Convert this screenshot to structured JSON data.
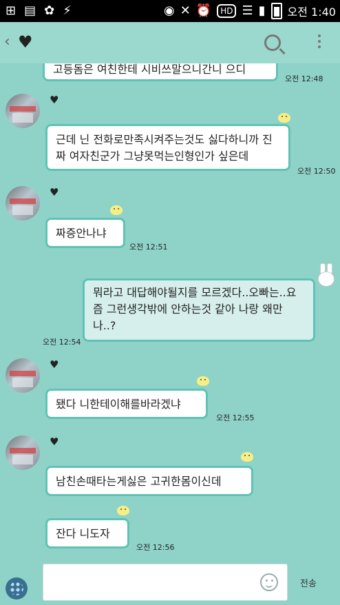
{
  "status_bar": {
    "clock": "오전 1:40",
    "hd": "HD"
  },
  "header": {
    "back_glyph": "‹",
    "chat_title_glyph": "♥"
  },
  "messages": [
    {
      "side": "left",
      "text": "고등돔은 여친한테 시비쓰말으니간니 으디",
      "time": "오전 12:48"
    },
    {
      "side": "left",
      "text": "근데 닌 전화로만족시켜주는것도 싫다하니까 진짜 여자친군가 그냥못먹는인형인가 싶은데",
      "time": "오전 12:50"
    },
    {
      "side": "left",
      "text": "짜증안나냐",
      "time": "오전 12:51"
    },
    {
      "side": "right",
      "text": "뭐라고 대답해야될지를 모르겠다..오빠는..요즘 그런생각밖에 안하는것 같아  나랑 왜만나..?",
      "time": "오전 12:54"
    },
    {
      "side": "left",
      "text": "됐다 니한테이해를바라겠냐",
      "time": "오전 12:55"
    },
    {
      "side": "left",
      "text": "남친손때타는게싫은 고귀한몸이신데",
      "time": ""
    },
    {
      "side": "left",
      "text": "잔다 니도자",
      "time": "오전 12:56"
    }
  ],
  "sender_heart": "♥",
  "input": {
    "placeholder": "",
    "send_label": "전송"
  }
}
